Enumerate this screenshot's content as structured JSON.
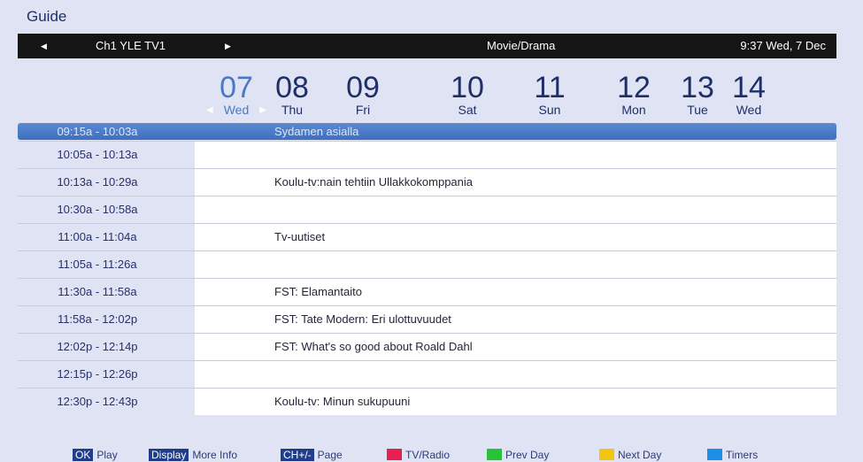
{
  "guide": {
    "title": "Guide"
  },
  "topbar": {
    "channel": "Ch1 YLE TV1",
    "genre": "Movie/Drama",
    "clock": "9:37 Wed, 7 Dec",
    "left_arrow_icon": "triangle-left-icon",
    "right_arrow_icon": "triangle-right-icon"
  },
  "days": [
    {
      "num": "07",
      "dow": "Wed",
      "selected": true
    },
    {
      "num": "08",
      "dow": "Thu"
    },
    {
      "num": "09",
      "dow": "Fri"
    },
    {
      "num": "10",
      "dow": "Sat"
    },
    {
      "num": "11",
      "dow": "Sun"
    },
    {
      "num": "12",
      "dow": "Mon"
    },
    {
      "num": "13",
      "dow": "Tue"
    },
    {
      "num": "14",
      "dow": "Wed"
    }
  ],
  "schedule": [
    {
      "time": "09:15a - 10:03a",
      "program": "Sydamen asialla",
      "active": true
    },
    {
      "time": "10:05a - 10:13a",
      "program": ""
    },
    {
      "time": "10:13a - 10:29a",
      "program": "Koulu-tv:nain tehtiin Ullakkokomppania"
    },
    {
      "time": "10:30a - 10:58a",
      "program": ""
    },
    {
      "time": "11:00a - 11:04a",
      "program": "Tv-uutiset"
    },
    {
      "time": "11:05a - 11:26a",
      "program": ""
    },
    {
      "time": "11:30a - 11:58a",
      "program": "FST: Elamantaito"
    },
    {
      "time": "11:58a - 12:02p",
      "program": "FST: Tate Modern: Eri ulottuvuudet"
    },
    {
      "time": "12:02p - 12:14p",
      "program": "FST: What's so good about Roald Dahl"
    },
    {
      "time": "12:15p - 12:26p",
      "program": ""
    },
    {
      "time": "12:30p - 12:43p",
      "program": "Koulu-tv: Minun sukupuuni"
    }
  ],
  "footer": {
    "ok": {
      "key": "OK",
      "label": "Play"
    },
    "display": {
      "key": "Display",
      "label": "More Info"
    },
    "ch": {
      "key": "CH+/-",
      "label": "Page"
    },
    "red": {
      "label": "TV/Radio",
      "color": "#e8204f"
    },
    "green": {
      "label": "Prev Day",
      "color": "#27c23a"
    },
    "yellow": {
      "label": "Next Day",
      "color": "#f2c511"
    },
    "blue": {
      "label": "Timers",
      "color": "#1f8ee8"
    }
  },
  "colors": {
    "background": "#dfe3f4",
    "topbar": "#151515",
    "selected_row": "#4a7bca",
    "selected_day": "#4a78c6",
    "text_dark": "#1d2f66"
  }
}
